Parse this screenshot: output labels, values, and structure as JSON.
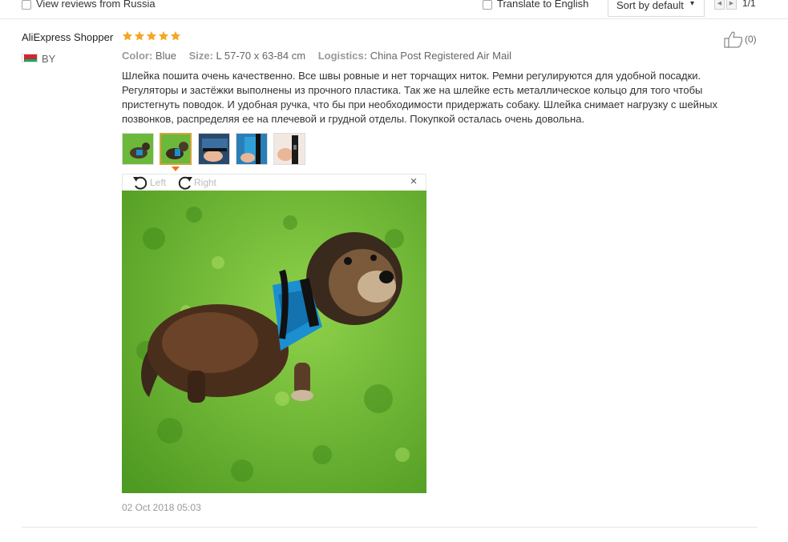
{
  "filters": {
    "view_reviews_label": "View reviews from Russia",
    "translate_label": "Translate to English",
    "sort_label": "Sort by default",
    "page_indicator": "1/1"
  },
  "review": {
    "user": "AliExpress Shopper",
    "rating": 5,
    "country": "BY",
    "likes": "(0)",
    "color_label": "Color:",
    "color_value": "Blue",
    "size_label": "Size:",
    "size_value": "L 57-70 x 63-84 cm",
    "logistics_label": "Logistics:",
    "logistics_value": "China Post Registered Air Mail",
    "text": "Шлейка пошита очень качественно. Все швы ровные и нет торчащих ниток. Ремни регулируются для удобной посадки. Регуляторы и застёжки выполнены из прочного пластика. Так же на шлейке есть металлическое кольцо для того чтобы пристегнуть поводок. И удобная ручка, что бы при необходимости придержать собаку. Шлейка снимает нагрузку с шейных позвонков, распределяя ее на плечевой и грудной отделы. Покупкой осталась очень довольна.",
    "photo_count": 5,
    "active_photo_index": 1,
    "viewer": {
      "rotate_left_label": "Left",
      "rotate_right_label": "Right",
      "close_glyph": "×"
    },
    "date": "02 Oct 2018 05:03"
  },
  "colors": {
    "star": "#f5a623",
    "active_thumb_border": "#d4a33a",
    "grass": "#5fb82a",
    "harness": "#1c8fd0"
  }
}
